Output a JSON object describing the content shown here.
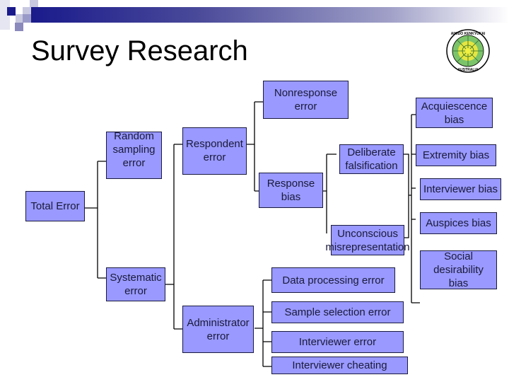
{
  "slide": {
    "title": "Survey Research",
    "logo": {
      "icon": "aikido-kenkyukai-logo-icon",
      "top_text": "AIKIDO KENKYUKAI",
      "bottom_text": "AUSTRALIA"
    },
    "box_fill": "#9999ff",
    "box_border": "#1a1a40",
    "accent": "#1a1a8c"
  },
  "tree": {
    "root": "Total Error",
    "random_sampling_error": "Random sampling error",
    "systematic_error": "Systematic error",
    "respondent_error": "Respondent error",
    "administrator_error": "Administrator error",
    "nonresponse_error": "Nonresponse error",
    "response_bias": "Response bias",
    "deliberate_falsification": "Deliberate falsification",
    "unconscious_misrepresentation": "Unconscious misrepresentation",
    "acquiescence_bias": "Acquiescence bias",
    "extremity_bias": "Extremity bias",
    "interviewer_bias": "Interviewer bias",
    "auspices_bias": "Auspices bias",
    "social_desirability_bias": "Social desirability bias",
    "data_processing_error": "Data processing error",
    "sample_selection_error": "Sample selection error",
    "interviewer_error": "Interviewer error",
    "interviewer_cheating": "Interviewer cheating"
  }
}
